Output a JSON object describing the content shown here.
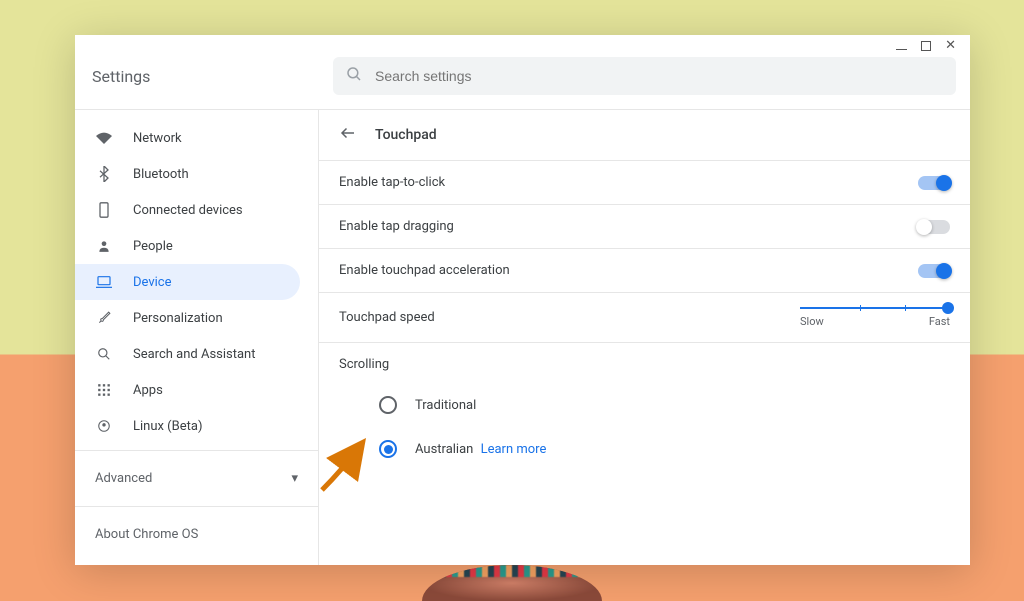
{
  "app": {
    "title": "Settings"
  },
  "search": {
    "placeholder": "Search settings"
  },
  "sidebar": {
    "items": [
      {
        "label": "Network"
      },
      {
        "label": "Bluetooth"
      },
      {
        "label": "Connected devices"
      },
      {
        "label": "People"
      },
      {
        "label": "Device"
      },
      {
        "label": "Personalization"
      },
      {
        "label": "Search and Assistant"
      },
      {
        "label": "Apps"
      },
      {
        "label": "Linux (Beta)"
      }
    ],
    "advanced": "Advanced",
    "about": "About Chrome OS"
  },
  "page": {
    "title": "Touchpad",
    "settings": {
      "tap_to_click": {
        "label": "Enable tap-to-click",
        "on": true
      },
      "tap_dragging": {
        "label": "Enable tap dragging",
        "on": false
      },
      "acceleration": {
        "label": "Enable touchpad acceleration",
        "on": true
      },
      "speed": {
        "label": "Touchpad speed",
        "slow": "Slow",
        "fast": "Fast"
      }
    },
    "scrolling": {
      "heading": "Scrolling",
      "options": {
        "traditional": "Traditional",
        "australian": "Australian",
        "learn_more": "Learn more"
      }
    }
  }
}
